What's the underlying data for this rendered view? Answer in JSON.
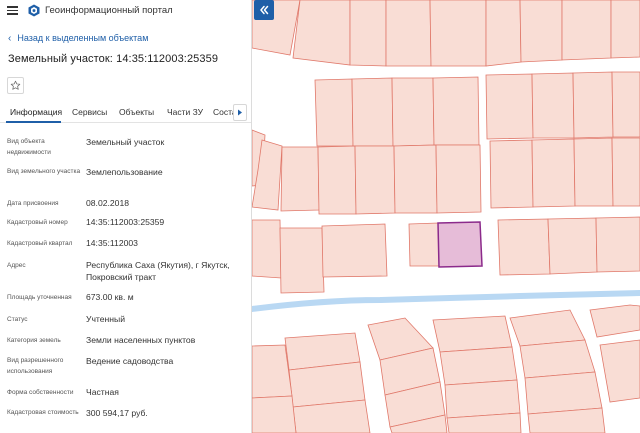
{
  "app": {
    "title": "Геоинформационный портал",
    "menu_icon": "hamburger-icon",
    "logo_icon": "portal-logo-icon"
  },
  "nav": {
    "back_label": "Назад к выделенным объектам"
  },
  "object": {
    "title": "Земельный участок: 14:35:112003:25359"
  },
  "tabs": [
    {
      "label": "Информация",
      "active": true
    },
    {
      "label": "Сервисы"
    },
    {
      "label": "Объекты"
    },
    {
      "label": "Части ЗУ"
    },
    {
      "label": "Соста"
    }
  ],
  "properties": [
    {
      "label": "Вид объекта недвижимости",
      "value": "Земельный участок"
    },
    {
      "label": "Вид земельного участка",
      "value": "Землепользование"
    },
    {
      "label": "Дата присвоения",
      "value": "08.02.2018"
    },
    {
      "label": "Кадастровый номер",
      "value": "14:35:112003:25359"
    },
    {
      "label": "Кадастровый квартал",
      "value": "14:35:112003"
    },
    {
      "label": "Адрес",
      "value": "Республика Саха (Якутия), г Якутск, Покровский тракт"
    },
    {
      "label": "Площадь уточненная",
      "value": "673.00 кв. м"
    },
    {
      "label": "Статус",
      "value": "Учтенный"
    },
    {
      "label": "Категория земель",
      "value": "Земли населенных пунктов"
    },
    {
      "label": "Вид разрешенного использования",
      "value": "Ведение садоводства"
    },
    {
      "label": "Форма собственности",
      "value": "Частная"
    },
    {
      "label": "Кадастровая стоимость",
      "value": "300 594,17 руб."
    }
  ],
  "map": {
    "parcel_fill": "#f9ddd5",
    "parcel_stroke": "#e0786a",
    "selected_fill": "#e6bcd8",
    "selected_stroke": "#8b2a8b",
    "river_color": "#b9d8f3",
    "collapse_icon": "double-chevron-left-icon"
  },
  "colors": {
    "accent": "#1f5fa8"
  }
}
